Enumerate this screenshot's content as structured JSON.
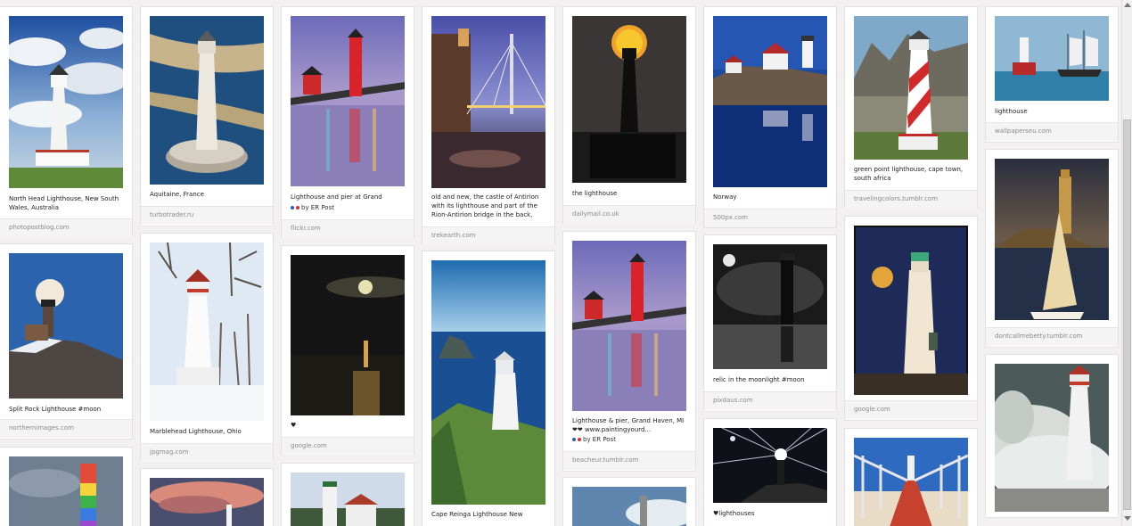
{
  "columns": [
    {
      "pins": [
        {
          "description": "North Head Lighthouse, New South Wales, Australia",
          "source": "photopostblog.com"
        },
        {
          "description": "Split Rock Lighthouse #moon",
          "source": "northernimages.com"
        },
        {
          "description": "",
          "source": ""
        }
      ]
    },
    {
      "pins": [
        {
          "description": "Aquitaine, France",
          "source": "turbotrader.ru"
        },
        {
          "description": "Marblehead Lighthouse, Ohio",
          "source": "jpgmag.com"
        },
        {
          "description": "",
          "source": ""
        }
      ]
    },
    {
      "pins": [
        {
          "description": "Lighthouse and pier at Grand Haven, MI",
          "via": "by ER Post",
          "source": "flickr.com"
        },
        {
          "description": "♥",
          "source": "google.com"
        },
        {
          "description": "",
          "source": ""
        }
      ]
    },
    {
      "pins": [
        {
          "description": "old and new, the castle of Antirion with its lighthouse and part of the Rion-Antirion bridge in the back, Greece",
          "source": "trekearth.com"
        },
        {
          "description": "Cape Reinga Lighthouse New Zealand",
          "source": ""
        }
      ]
    },
    {
      "pins": [
        {
          "description": "the lighthouse",
          "source": "dailymail.co.uk"
        },
        {
          "description": "Lighthouse & pier, Grand Haven, MI ❤❤ www.paintingyourd...",
          "via": "by ER Post",
          "source": "beacheur.tumblr.com"
        },
        {
          "description": "",
          "source": ""
        }
      ]
    },
    {
      "pins": [
        {
          "description": "Norway",
          "source": "500px.com"
        },
        {
          "description": "relic in the moonlight #moon",
          "source": "pixdaus.com"
        },
        {
          "description": "♥lighthouses",
          "source": ""
        }
      ]
    },
    {
      "pins": [
        {
          "description": "green point lighthouse, cape town, south africa",
          "source": "travelingcolors.tumblr.com"
        },
        {
          "description": "",
          "source": "google.com"
        },
        {
          "description": "",
          "source": ""
        }
      ]
    },
    {
      "pins": [
        {
          "description": "lighthouse",
          "source": "wallpaperseu.com"
        },
        {
          "description": "",
          "source": "dontcallmebetty.tumblr.com"
        },
        {
          "description": "",
          "source": ""
        }
      ]
    }
  ],
  "colors": {
    "page_bg": "#f2f0f0",
    "card_bg": "#ffffff",
    "source_bar": "#f5f4f4",
    "source_text": "#8a8888"
  }
}
